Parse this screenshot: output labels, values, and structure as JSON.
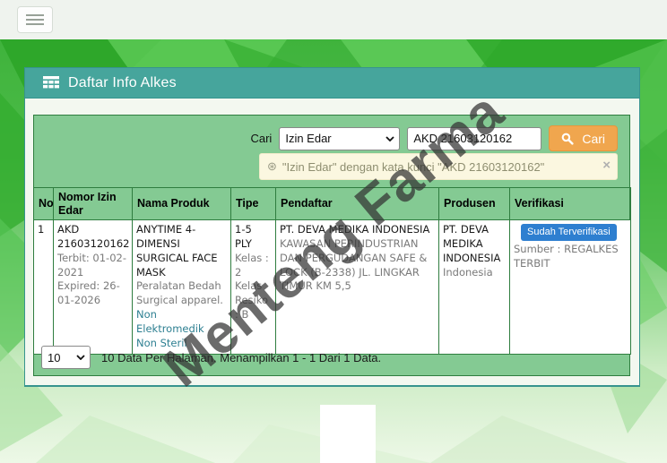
{
  "panel": {
    "title": "Daftar Info Alkes"
  },
  "search": {
    "label": "Cari",
    "filter_value": "Izin Edar",
    "query_value": "AKD 21603120162",
    "button_label": "Cari"
  },
  "alert": {
    "icon_glyph": "⊛",
    "message": "\"Izin Edar\" dengan kata kunci \"AKD 21603120162\"",
    "close_glyph": "×"
  },
  "table": {
    "headers": [
      "No",
      "Nomor Izin Edar",
      "Nama Produk",
      "Tipe",
      "Pendaftar",
      "Produsen",
      "Verifikasi"
    ],
    "rows": [
      {
        "no": "1",
        "izin": {
          "number": "AKD 21603120162",
          "terbit": "Terbit: 01-02-2021",
          "expired": "Expired: 26-01-2026"
        },
        "produk": {
          "name": "ANYTIME 4-DIMENSI SURGICAL FACE MASK",
          "category": "Peralatan Bedah Surgical apparel.",
          "tag1": "Non Elektromedik",
          "tag2": "Non Steril"
        },
        "tipe": {
          "type": "1-5 PLY",
          "kelas": "Kelas : 2",
          "kelas_resiko": "Kelas Resiko : B"
        },
        "pendaftar": {
          "name": "PT. DEVA MEDIKA INDONESIA",
          "address": "KAWASAN PERINDUSTRIAN DAN PERGUDANGAN SAFE & LOCK (B-2338) JL. LINGKAR TIMUR KM 5,5"
        },
        "produsen": {
          "name": "PT. DEVA MEDIKA INDONESIA",
          "country": "Indonesia"
        },
        "verifikasi": {
          "badge": "Sudah Terverifikasi",
          "sumber": "Sumber : REGALKES TERBIT"
        }
      }
    ]
  },
  "pagination": {
    "page_size": "10",
    "summary": "10 Data Per Halaman. Menampilkan 1 - 1 Dari 1 Data."
  },
  "watermark": {
    "text": "Menteng Farma"
  },
  "colors": {
    "panel_header_teal": "#46a59c",
    "content_box_green": "#84ca93",
    "table_border_green": "#2f7d3f",
    "search_button_orange": "#f0a64e",
    "badge_blue": "#2e7fd0",
    "alert_bg": "#fbf7e0"
  }
}
